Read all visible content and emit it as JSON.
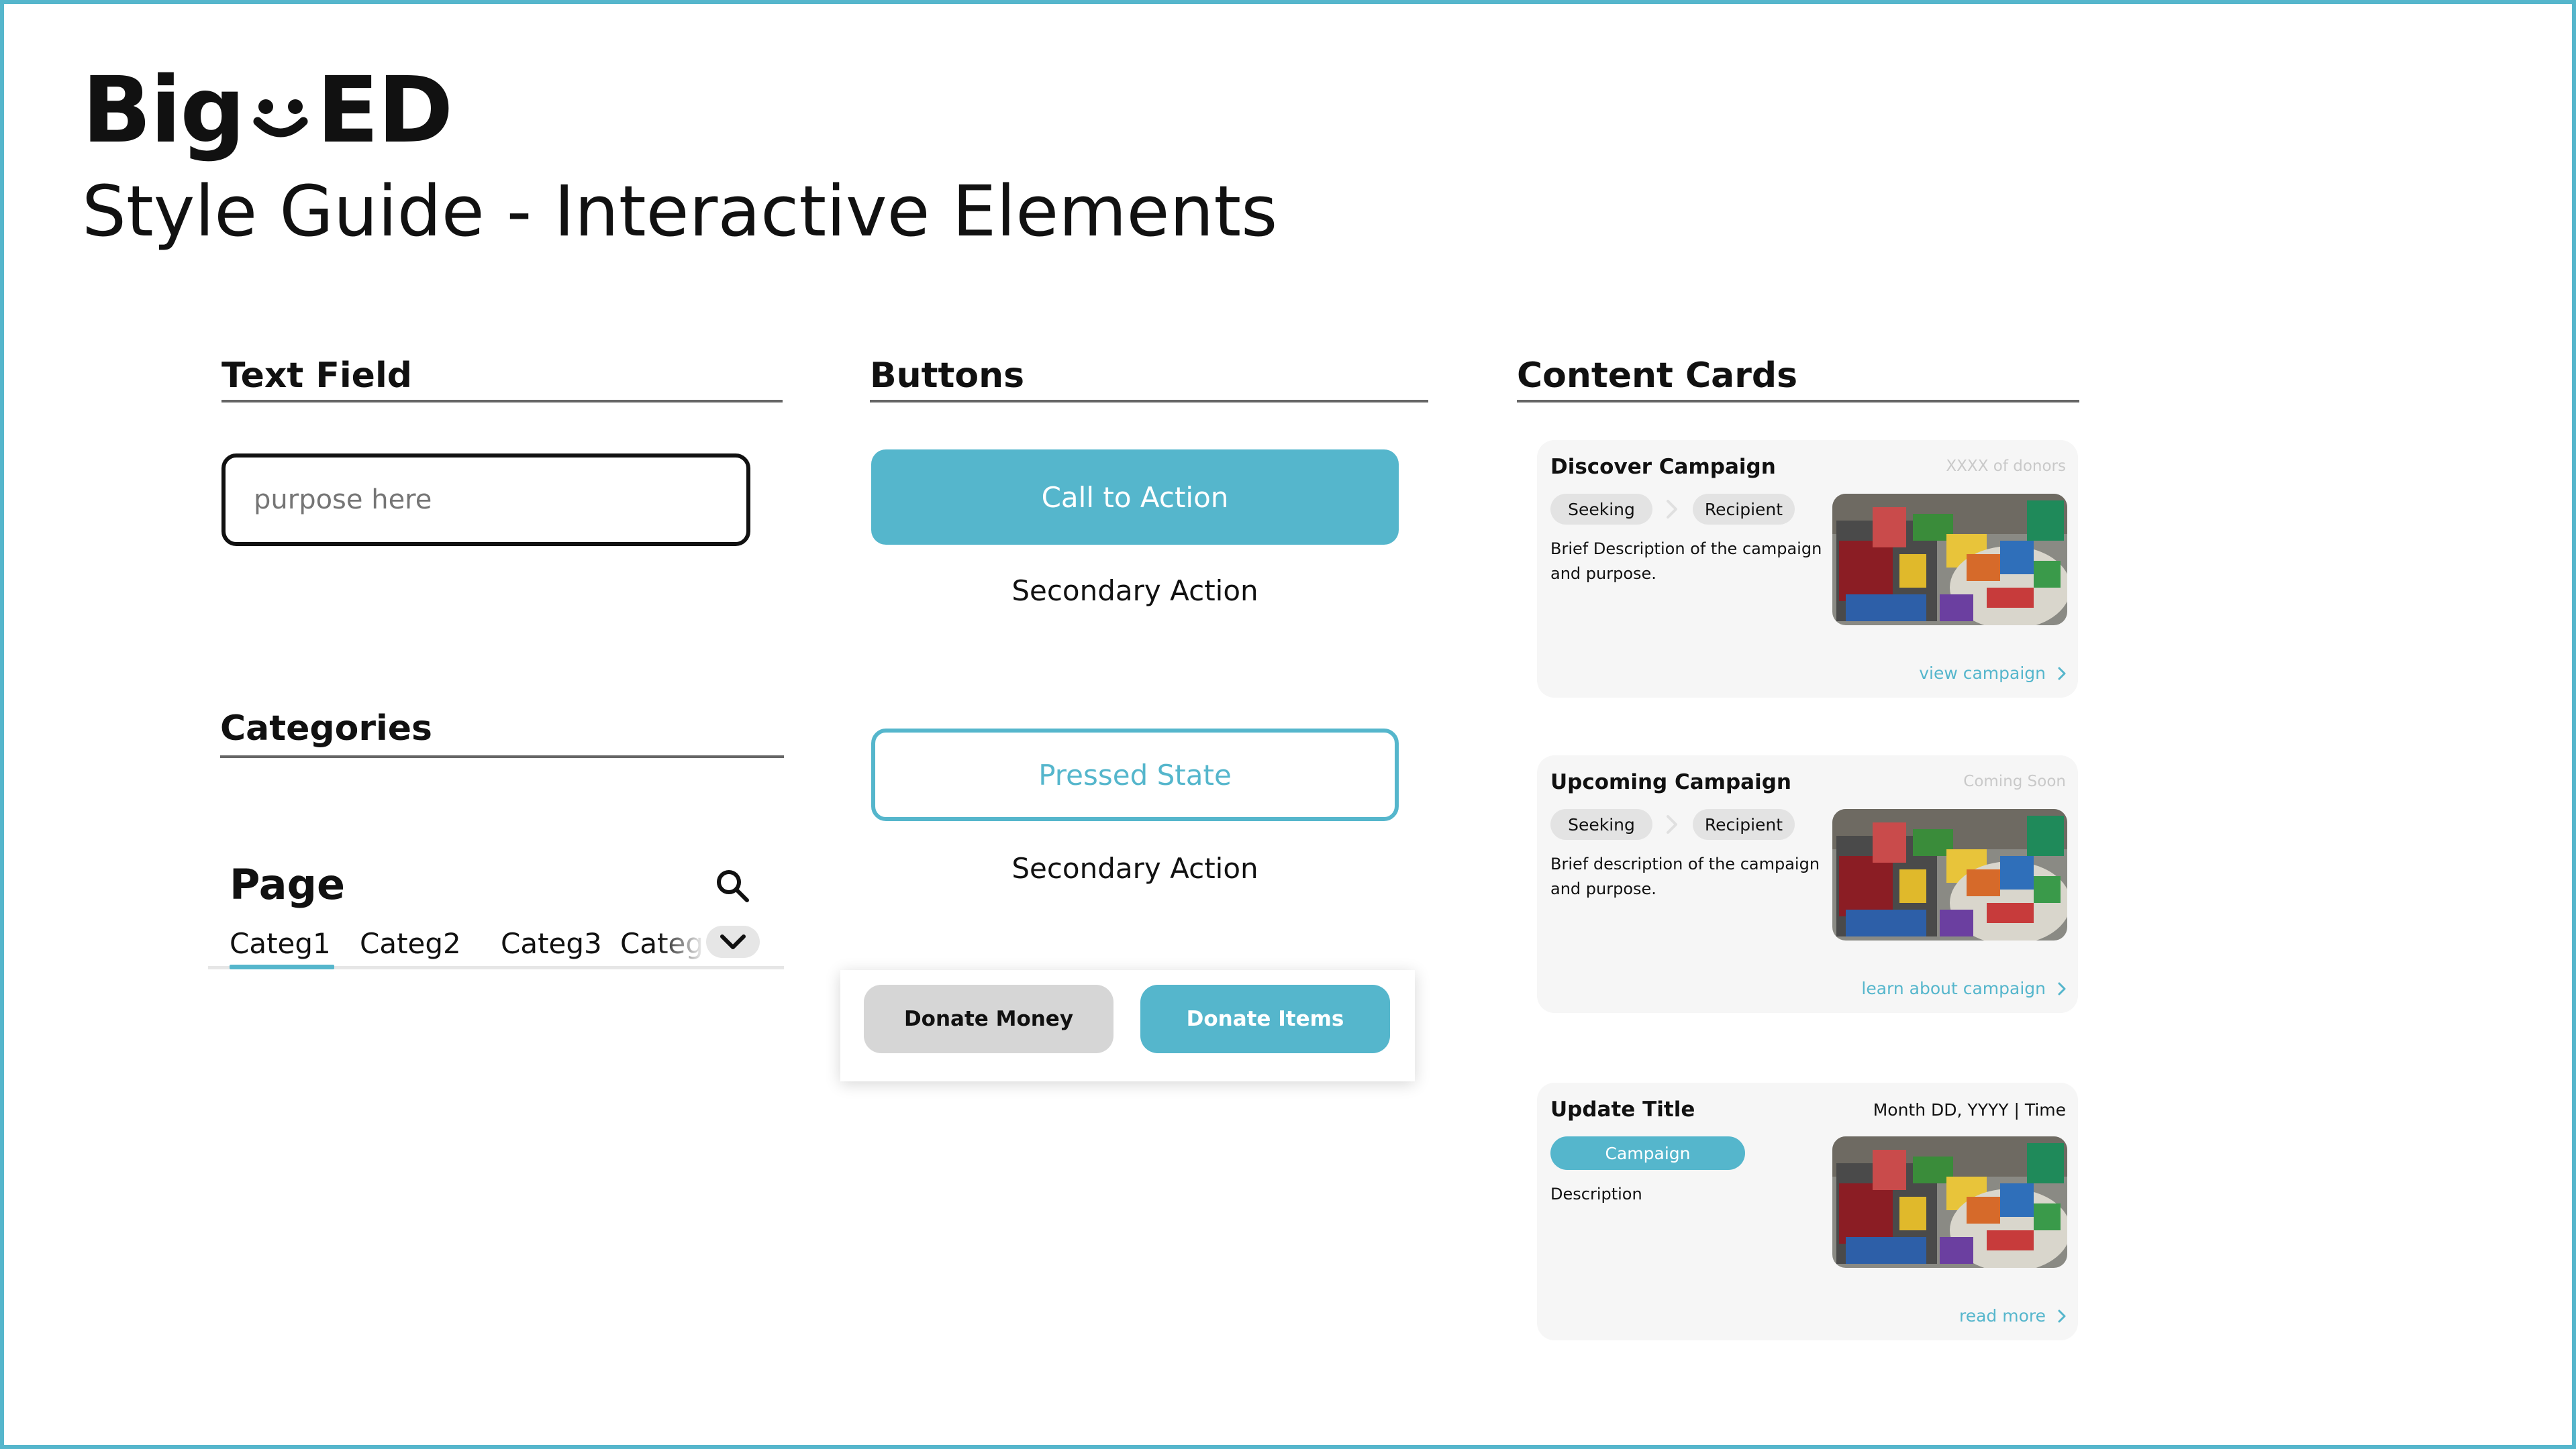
{
  "brand": {
    "logo_left": "Big",
    "logo_right": "ED"
  },
  "page": {
    "title": "Style Guide - Interactive Elements"
  },
  "colors": {
    "accent": "#55b6cc",
    "frame": "#55b6cc",
    "card_bg": "#f6f6f6",
    "chip_bg": "#e3e3e3",
    "muted_button": "#d6d6d6"
  },
  "sections": {
    "text_field": "Text Field",
    "buttons": "Buttons",
    "content_cards": "Content Cards",
    "categories": "Categories"
  },
  "text_field": {
    "placeholder": "purpose here"
  },
  "buttons": {
    "cta": "Call to Action",
    "secondary_1": "Secondary Action",
    "pressed": "Pressed State",
    "secondary_2": "Secondary Action",
    "donate_money": "Donate Money",
    "donate_items": "Donate Items"
  },
  "categories": {
    "page_label": "Page",
    "tabs": [
      "Categ1",
      "Categ2",
      "Categ3",
      "Categ"
    ],
    "active_tab": "Categ1",
    "icons": {
      "search": "search-icon",
      "more": "chevron-down-icon"
    }
  },
  "cards": [
    {
      "title": "Discover Campaign",
      "meta": "XXXX of donors",
      "chips": [
        "Seeking",
        "Recipient"
      ],
      "description": "Brief Description of the campaign and purpose.",
      "link": "view campaign"
    },
    {
      "title": "Upcoming Campaign",
      "meta": "Coming Soon",
      "chips": [
        "Seeking",
        "Recipient"
      ],
      "description": "Brief description of the campaign and purpose.",
      "link": "learn about campaign"
    },
    {
      "title": "Update Title",
      "meta": "Month DD, YYYY | Time",
      "tag": "Campaign",
      "description": "Description",
      "link": "read more"
    }
  ]
}
